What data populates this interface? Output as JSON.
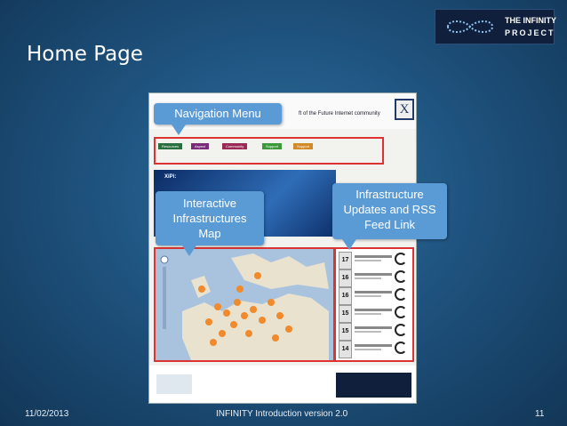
{
  "slide": {
    "title": "Home Page",
    "footer_date": "11/02/2013",
    "footer_center": "INFINITY Introduction version 2.0",
    "page_number": "11"
  },
  "logo": {
    "line1": "THE INFINITY",
    "line2": "PROJECT"
  },
  "screenshot": {
    "header_text": "ft of the Future Internet community",
    "nav_buttons": [
      "Resources",
      "Aspect",
      "Community",
      "Support",
      "Support"
    ],
    "hero_title": "XiPi:",
    "feed_dates": [
      "17",
      "16",
      "16",
      "15",
      "15",
      "14"
    ]
  },
  "callouts": {
    "navigation": "Navigation Menu",
    "map_line1": "Interactive",
    "map_line2": "Infrastructures",
    "map_line3": "Map",
    "infra_line1": "Infrastructure",
    "infra_line2": "Updates and RSS",
    "infra_line3": "Feed Link"
  },
  "colors": {
    "callout": "#5b9bd5",
    "highlight_border": "#dd3333",
    "background": "#1f5480",
    "map_dots": "#f08a2c"
  }
}
